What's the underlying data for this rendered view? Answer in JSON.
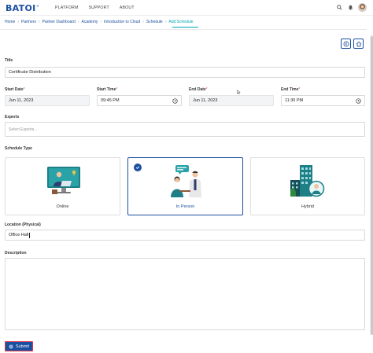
{
  "header": {
    "logo_text": "BATOI",
    "logo_mark": "®",
    "nav": [
      "PLATFORM",
      "SUPPORT",
      "ABOUT"
    ]
  },
  "breadcrumb": [
    "Home",
    "Partners",
    "Partner Dashboard",
    "Academy",
    "Introduction to Cloud",
    "Schedule",
    "Add Schedule"
  ],
  "form": {
    "title": {
      "label": "Title",
      "value": "Certificate Distribution"
    },
    "start_date": {
      "label": "Start Date",
      "value": "Jun 11, 2023"
    },
    "start_time": {
      "label": "Start Time",
      "value": "09:45 PM"
    },
    "end_date": {
      "label": "End Date",
      "value": "Jun 11, 2023"
    },
    "end_time": {
      "label": "End Time",
      "value": "11:30 PM"
    },
    "required_mark": "*",
    "experts": {
      "label": "Experts",
      "placeholder": "Select Experts..."
    },
    "schedule_type": {
      "label": "Schedule Type",
      "options": [
        "Online",
        "In Person",
        "Hybrid"
      ],
      "selected": "In Person"
    },
    "location": {
      "label": "Location (Physical)",
      "value": "Office Hall"
    },
    "description": {
      "label": "Description",
      "value": ""
    },
    "submit_label": "Submit"
  },
  "colors": {
    "primary": "#1b4fa0",
    "accent": "#00a7b5",
    "required": "#d33333"
  }
}
